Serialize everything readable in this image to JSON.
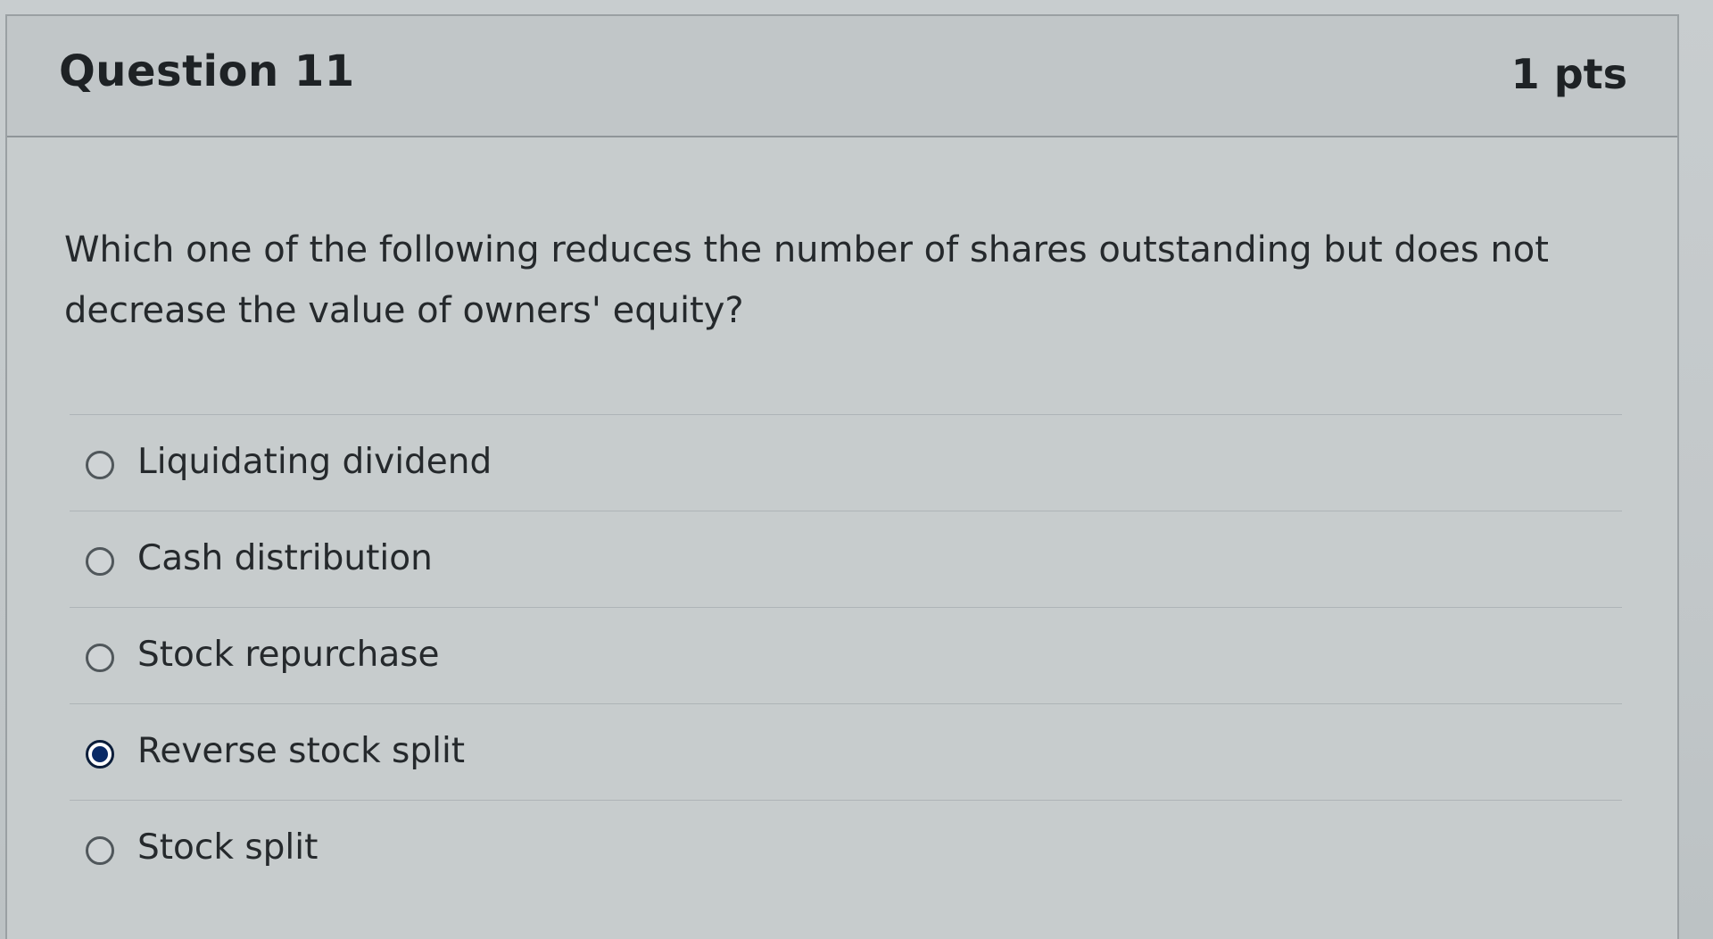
{
  "question": {
    "title": "Question 11",
    "points": "1 pts",
    "text": "Which one of the following reduces the number of shares outstanding but does not decrease the value of owners' equity?"
  },
  "answers": [
    {
      "label": "Liquidating dividend",
      "selected": false
    },
    {
      "label": "Cash distribution",
      "selected": false
    },
    {
      "label": "Stock repurchase",
      "selected": false
    },
    {
      "label": "Reverse stock split",
      "selected": true
    },
    {
      "label": "Stock split",
      "selected": false
    }
  ],
  "colors": {
    "selected_radio": "#0a2a66",
    "text": "#25292c"
  }
}
